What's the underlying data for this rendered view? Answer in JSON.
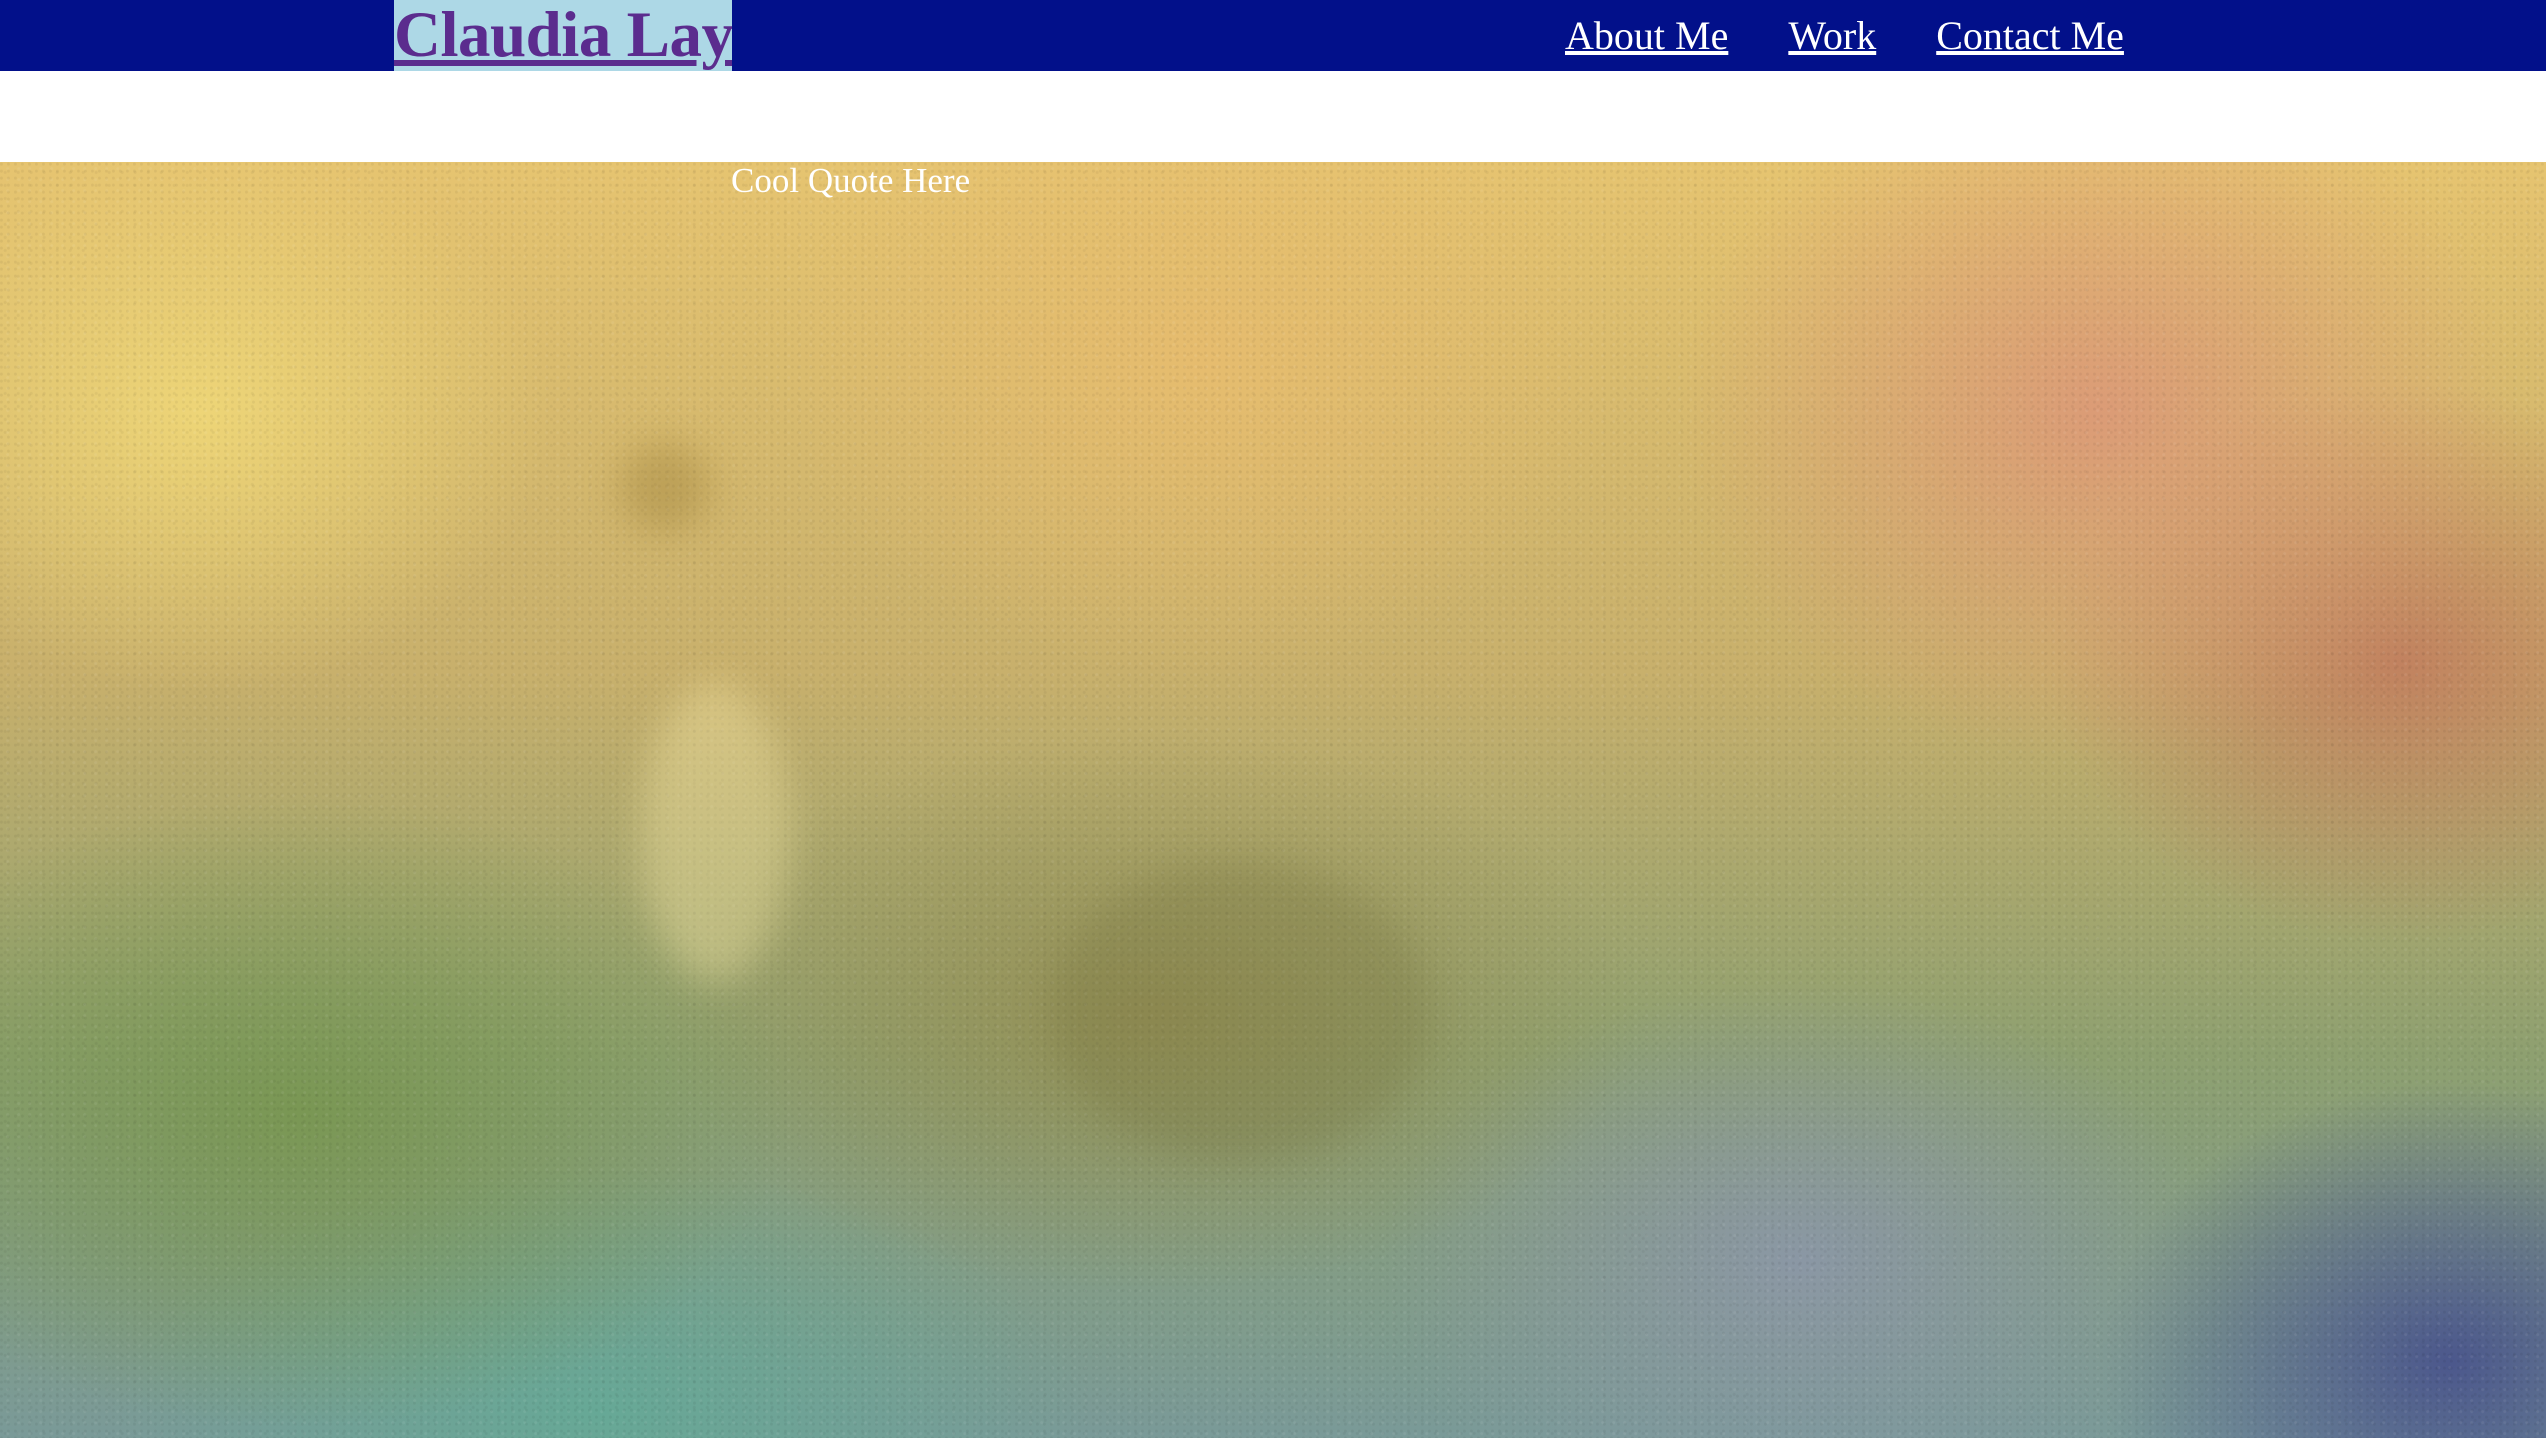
{
  "header": {
    "brand": "Claudia Lay",
    "nav": [
      {
        "label": "About Me"
      },
      {
        "label": "Work"
      },
      {
        "label": "Contact Me"
      }
    ]
  },
  "hero": {
    "quote": "Cool Quote Here"
  },
  "colors": {
    "navbar_bg": "#02108a",
    "brand_bg": "#add8e6",
    "brand_text": "#5b2c8e",
    "nav_text": "#ffffff"
  }
}
